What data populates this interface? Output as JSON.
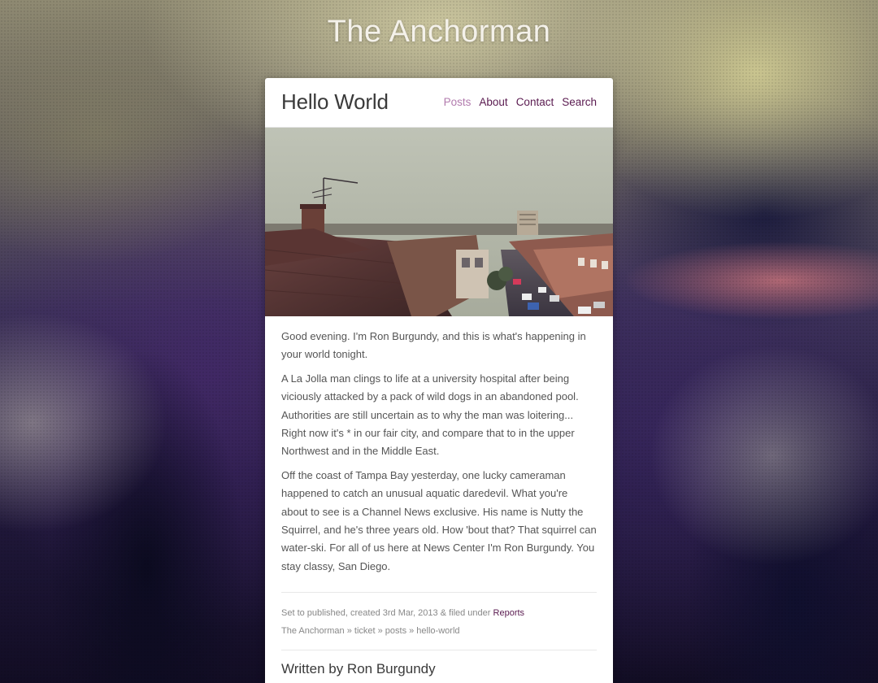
{
  "site": {
    "title": "The Anchorman"
  },
  "post": {
    "title": "Hello World",
    "paragraphs": [
      "Good evening. I'm Ron Burgundy, and this is what's happening in your world tonight.",
      "A La Jolla man clings to life at a university hospital after being viciously attacked by a pack of wild dogs in an abandoned pool. Authorities are still uncertain as to why the man was loitering... Right now it's * in our fair city, and compare that to in the upper Northwest and in the Middle East.",
      "Off the coast of Tampa Bay yesterday, one lucky cameraman happened to catch an unusual aquatic daredevil. What you're about to see is a Channel News exclusive. His name is Nutty the Squirrel, and he's three years old. How 'bout that? That squirrel can water-ski. For all of us here at News Center I'm Ron Burgundy. You stay classy, San Diego."
    ],
    "meta": {
      "status_text": "Set to published, created 3rd Mar, 2013 & filed under",
      "category_link": "Reports",
      "breadcrumb": "The Anchorman » ticket » posts » hello-world"
    },
    "author_heading": "Written by Ron Burgundy"
  },
  "nav": {
    "items": [
      {
        "label": "Posts",
        "active": true
      },
      {
        "label": "About",
        "active": false
      },
      {
        "label": "Contact",
        "active": false
      },
      {
        "label": "Search",
        "active": false
      }
    ]
  },
  "colors": {
    "accent": "#5a1b50",
    "accent_active": "#b27bae"
  }
}
